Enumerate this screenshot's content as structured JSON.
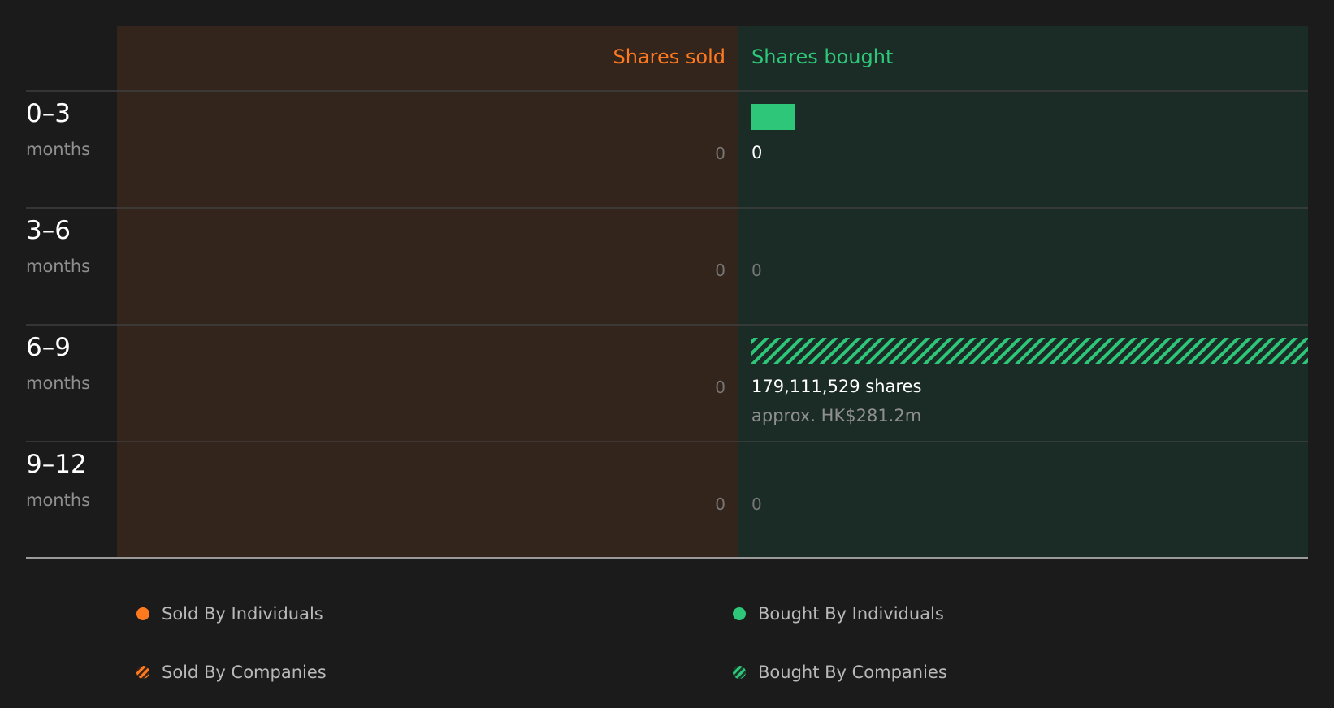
{
  "chart_data": {
    "type": "bar",
    "column_headers": {
      "sold": "Shares sold",
      "bought": "Shares bought"
    },
    "categories": [
      {
        "range": "0–3",
        "unit": "months"
      },
      {
        "range": "3–6",
        "unit": "months"
      },
      {
        "range": "6–9",
        "unit": "months"
      },
      {
        "range": "9–12",
        "unit": "months"
      }
    ],
    "series": [
      {
        "name": "Sold By Individuals",
        "side": "sold",
        "pattern": "solid",
        "values": [
          0,
          0,
          0,
          0
        ]
      },
      {
        "name": "Sold By Companies",
        "side": "sold",
        "pattern": "hatched",
        "values": [
          0,
          0,
          0,
          0
        ]
      },
      {
        "name": "Bought By Individuals",
        "side": "bought",
        "pattern": "solid",
        "values": [
          13000000,
          0,
          0,
          0
        ]
      },
      {
        "name": "Bought By Companies",
        "side": "bought",
        "pattern": "hatched",
        "values": [
          0,
          0,
          166111529,
          0
        ]
      }
    ],
    "sold_labels": [
      "0",
      "0",
      "0",
      "0"
    ],
    "bought_labels": [
      "0",
      "0",
      "179,111,529 shares",
      "0"
    ],
    "bought_sublabels": [
      "",
      "",
      "approx. HK$281.2m",
      ""
    ],
    "legend_placement": "bottom"
  },
  "colors": {
    "background": "#1b1b1b",
    "sold_accent": "#ff7a1f",
    "bought_accent": "#2ec77a",
    "sold_panel": "#33241c",
    "bought_panel": "#1b2b25",
    "separator": "#3e3e3e",
    "baseline": "#9a9a9a",
    "zero_text": "#777777",
    "muted_text": "#8f8f8f",
    "value_text": "#ffffff"
  }
}
